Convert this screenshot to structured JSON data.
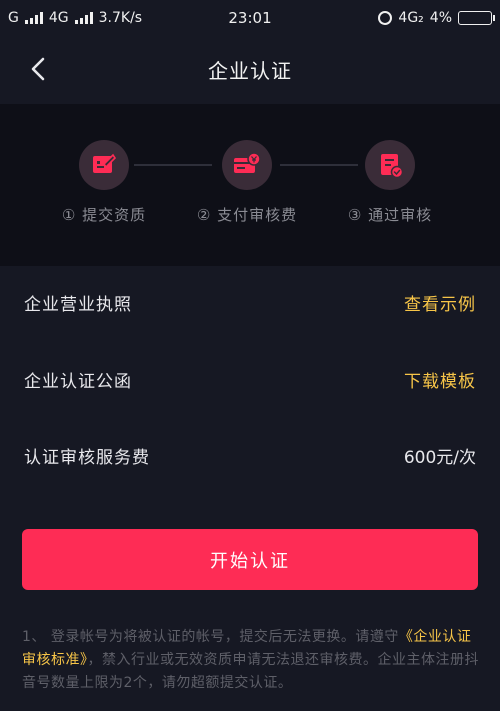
{
  "status_bar": {
    "carrier_left": "G",
    "network": "4G",
    "speed": "3.7K/s",
    "time": "23:01",
    "network_right": "4G₂",
    "battery": "4%"
  },
  "nav": {
    "title": "企业认证"
  },
  "steps": [
    {
      "label": "① 提交资质",
      "icon": "document-edit-icon"
    },
    {
      "label": "② 支付审核费",
      "icon": "payment-card-icon"
    },
    {
      "label": "③ 通过审核",
      "icon": "approved-badge-icon"
    }
  ],
  "rows": {
    "license": {
      "label": "企业营业执照",
      "action": "查看示例"
    },
    "letter": {
      "label": "企业认证公函",
      "action": "下载模板"
    },
    "fee": {
      "label": "认证审核服务费",
      "value": "600元/次"
    }
  },
  "start_button": "开始认证",
  "notice": {
    "part1": "1、 登录帐号为将被认证的帐号，提交后无法更换。请遵守",
    "link": "《企业认证审核标准》",
    "part2": "，禁入行业或无效资质申请无法退还审核费。企业主体注册抖音号数量上限为2个，请勿超额提交认证。"
  },
  "colors": {
    "background": "#161823",
    "accent": "#fe2c55",
    "link": "#f7c548"
  }
}
